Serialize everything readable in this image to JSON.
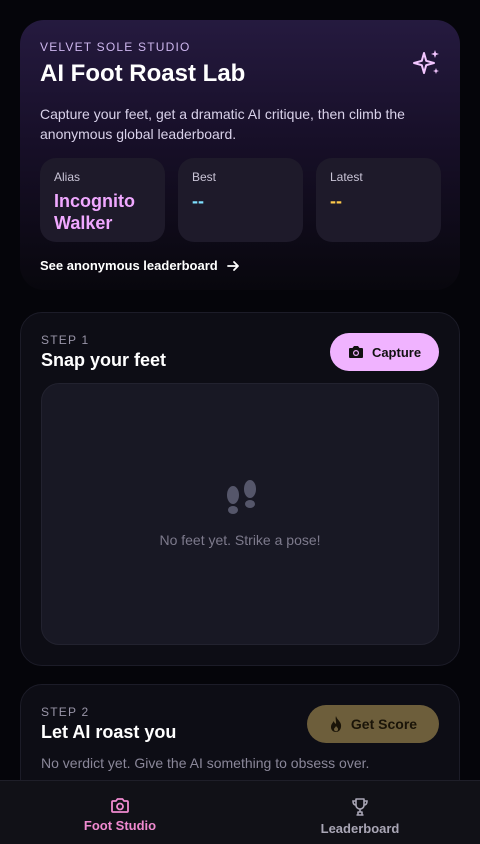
{
  "hero": {
    "studio": "VELVET SOLE STUDIO",
    "title": "AI Foot Roast Lab",
    "description": "Capture your feet, get a dramatic AI critique, then climb the anonymous global leaderboard.",
    "sparkle_icon": "sparkles-icon",
    "stats": {
      "alias_label": "Alias",
      "alias_value": "Incognito Walker",
      "best_label": "Best",
      "best_value": "--",
      "latest_label": "Latest",
      "latest_value": "--"
    },
    "leaderboard_link": "See anonymous leaderboard"
  },
  "step1": {
    "label": "STEP 1",
    "title": "Snap your feet",
    "button": "Capture",
    "empty_text": "No feet yet. Strike a pose!"
  },
  "step2": {
    "label": "STEP 2",
    "title": "Let AI roast you",
    "button": "Get Score",
    "verdict": "No verdict yet. Give the AI something to obsess over."
  },
  "nav": {
    "items": [
      {
        "label": "Foot Studio",
        "icon": "camera-icon",
        "active": true
      },
      {
        "label": "Leaderboard",
        "icon": "trophy-icon",
        "active": false
      }
    ]
  },
  "colors": {
    "accent_pink": "#f0b3ff",
    "alias": "#f0a8ff",
    "best": "#7ee0ff",
    "latest": "#ffc94a",
    "nav_active": "#f08ad0"
  }
}
